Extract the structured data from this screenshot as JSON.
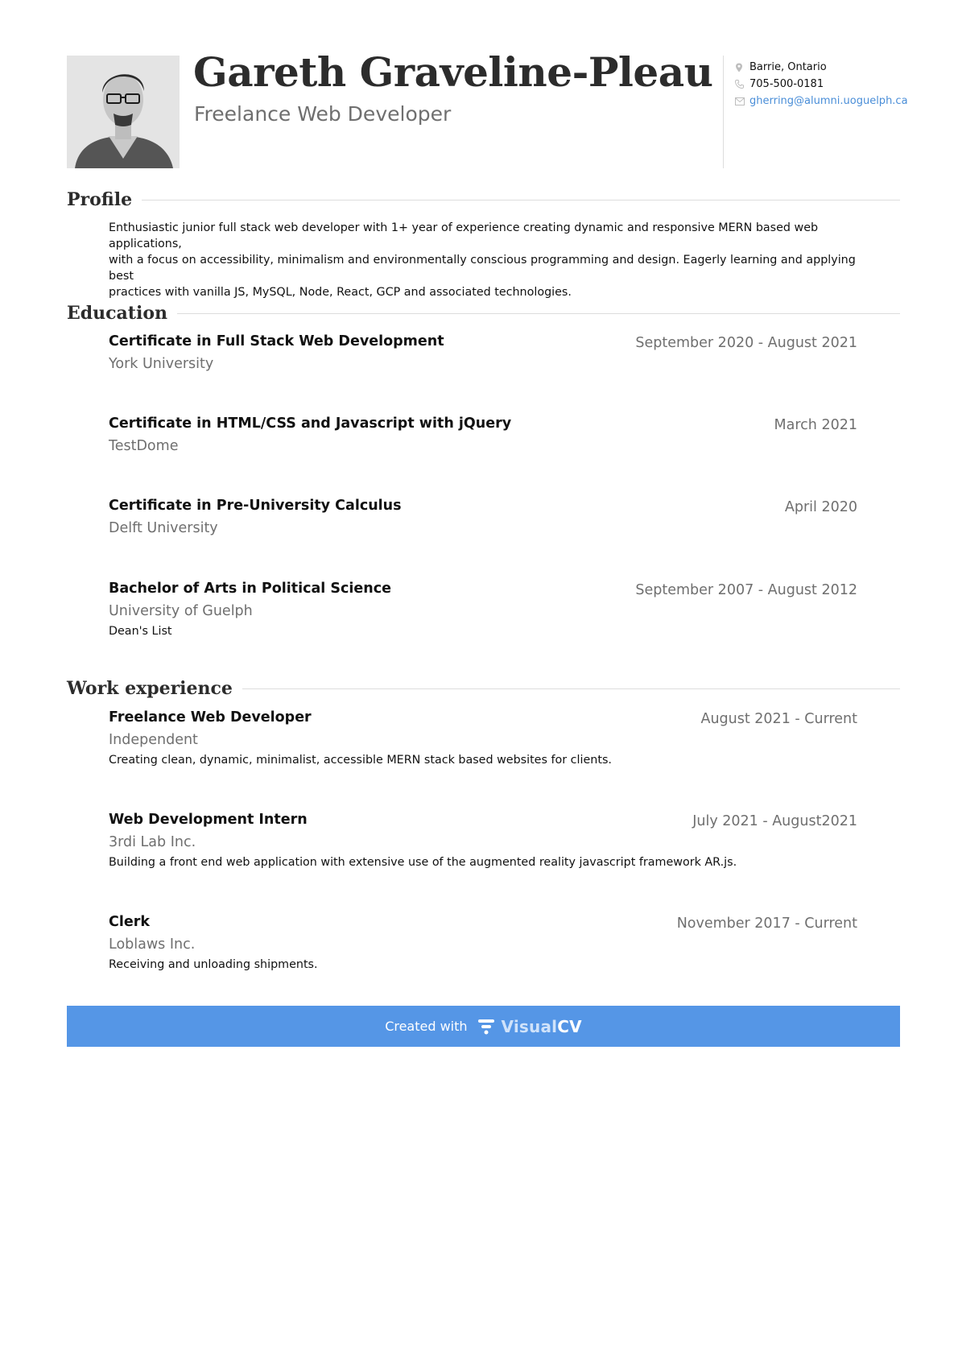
{
  "header": {
    "name": "Gareth Graveline-Pleau",
    "title": "Freelance Web Developer",
    "photo_icon": "profile-photo"
  },
  "contact": {
    "location": "Barrie, Ontario",
    "phone": "705-500-0181",
    "email": "gherring@alumni.uoguelph.ca"
  },
  "sections": {
    "profile": "Profile",
    "education": "Education",
    "work": "Work experience"
  },
  "profile": {
    "line1": "Enthusiastic junior full stack web developer with 1+ year of experience creating dynamic and responsive MERN based web applications,",
    "line2": "with a focus on accessibility, minimalism and environmentally conscious programming and design. Eagerly learning and applying best",
    "line3": "practices with vanilla JS, MySQL, Node, React, GCP and associated technologies."
  },
  "education": [
    {
      "title": "Certificate in Full Stack Web Development",
      "org": "York University",
      "date": "September 2020 - August 2021"
    },
    {
      "title": "Certificate in HTML/CSS and Javascript with jQuery",
      "org": "TestDome",
      "date": "March 2021"
    },
    {
      "title": "Certificate in Pre-University Calculus",
      "org": "Delft University",
      "date": "April 2020"
    },
    {
      "title": "Bachelor of Arts in Political Science",
      "org": "University of Guelph",
      "date": "September 2007 - August 2012",
      "desc": "Dean's List"
    }
  ],
  "work": [
    {
      "title": "Freelance Web Developer",
      "org": "Independent",
      "date": "August 2021 - Current",
      "desc": "Creating clean, dynamic, minimalist, accessible MERN stack based websites for clients."
    },
    {
      "title": "Web Development Intern",
      "org": "3rdi Lab Inc.",
      "date": "July 2021 - August2021",
      "desc": "Building a front end web application with extensive use of the augmented reality javascript framework AR.js."
    },
    {
      "title": "Clerk",
      "org": "Loblaws Inc.",
      "date": "November 2017 - Current",
      "desc": "Receiving and unloading shipments."
    }
  ],
  "footer": {
    "created_with": "Created with",
    "logo_light": "Visual",
    "logo_bold": "CV"
  },
  "colors": {
    "banner": "#5596e6",
    "link": "#4a8ed8",
    "muted": "#6f6f6f"
  }
}
